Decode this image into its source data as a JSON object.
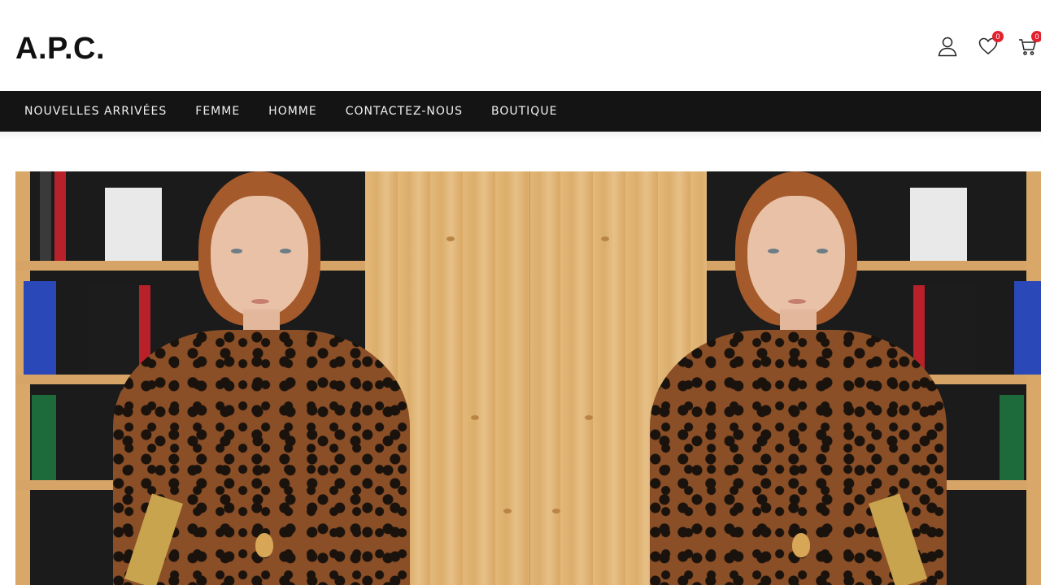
{
  "brand": {
    "logo_text": "A.P.C."
  },
  "header_icons": {
    "account": {
      "icon": "user-icon"
    },
    "wishlist": {
      "icon": "heart-icon",
      "count": "0"
    },
    "cart": {
      "icon": "cart-icon",
      "count": "0"
    }
  },
  "nav": {
    "items": [
      {
        "label": "NOUVELLES ARRIVÉES"
      },
      {
        "label": "FEMME"
      },
      {
        "label": "HOMME"
      },
      {
        "label": "CONTACTEZ-NOUS"
      },
      {
        "label": "BOUTIQUE"
      }
    ]
  },
  "colors": {
    "nav_background": "#141414",
    "nav_text": "#f2f2f2",
    "badge": "#e1222e",
    "logo": "#111111"
  }
}
